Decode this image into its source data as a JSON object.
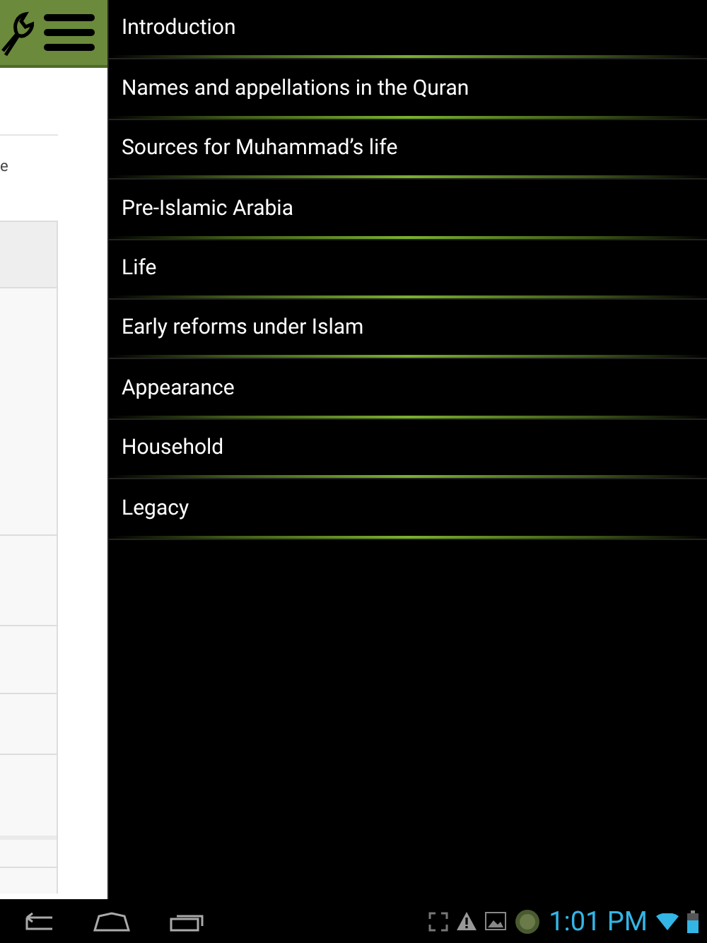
{
  "page_fragment": {
    "text": "e"
  },
  "drawer": {
    "items": [
      {
        "label": "Introduction"
      },
      {
        "label": "Names and appellations in the Quran"
      },
      {
        "label": "Sources for Muhammad’s life"
      },
      {
        "label": "Pre-Islamic Arabia"
      },
      {
        "label": "Life"
      },
      {
        "label": "Early reforms under Islam"
      },
      {
        "label": "Appearance"
      },
      {
        "label": "Household"
      },
      {
        "label": "Legacy"
      }
    ]
  },
  "status_bar": {
    "time": "1:01 PM"
  }
}
